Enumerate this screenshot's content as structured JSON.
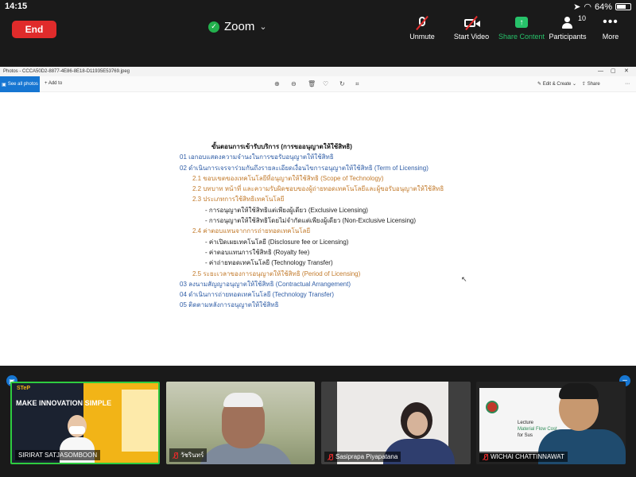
{
  "status": {
    "time": "14:15",
    "battery": "64%"
  },
  "zoom": {
    "end_label": "End",
    "meeting_title": "Zoom",
    "toolbar": {
      "unmute": "Unmute",
      "start_video": "Start Video",
      "share_content": "Share Content",
      "participants": "Participants",
      "participants_count": "10",
      "more": "More"
    }
  },
  "photos": {
    "window_title": "Photos - CCCA50D2-8877-4E86-8E18-D11935E53769.jpeg",
    "see_all": "See all photos",
    "add_to": "Add to",
    "edit_create": "Edit & Create",
    "share": "Share"
  },
  "document": {
    "title": "ขั้นตอนการเข้ารับบริการ (การขออนุญาตให้ใช้สิทธิ)",
    "lines": [
      "01 เอกอบแสดงความจำนงในการขอรับอนุญาตให้ใช้สิทธิ",
      "02 ดำเนินการเจรจาร่วมกันถึงรายละเอียดเงื่อนไขการอนุญาตให้ใช้สิทธิ (Term of Licensing)",
      "2.1 ขอบเขตของเทคโนโลยีที่อนุญาตให้ใช้สิทธิ (Scope of Technology)",
      "2.2 บทบาท หน้าที่ และความรับผิดชอบของผู้ถ่ายทอดเทคโนโลยีและผู้ขอรับอนุญาตให้ใช้สิทธิ",
      "2.3 ประเภทการใช้สิทธิเทคโนโลยี",
      "- การอนุญาตให้ใช้สิทธิแต่เพียงผู้เดียว (Exclusive Licensing)",
      "- การอนุญาตให้ใช้สิทธิโดยไม่จำกัดแต่เพียงผู้เดียว (Non-Exclusive Licensing)",
      "2.4 ค่าตอบแทนจากการถ่ายทอดเทคโนโลยี",
      "- ค่าเปิดเผยเทคโนโลยี (Disclosure fee or Licensing)",
      "- ค่าตอบแทนการใช้สิทธิ (Royalty fee)",
      "- ค่าถ่ายทอดเทคโนโลยี (Technology Transfer)",
      "2.5 ระยะเวลาของการอนุญาตให้ใช้สิทธิ (Period of Licensing)",
      "03 ลงนามสัญญาอนุญาตให้ใช้สิทธิ (Contractual Arrangement)",
      "04 ดำเนินการถ่ายทอดเทคโนโลยี (Technology Transfer)",
      "05 ติดตามหลังการอนุญาตให้ใช้สิทธิ"
    ]
  },
  "participants": [
    {
      "name": "SIRIRAT SATJASOMBOON",
      "muted": false,
      "slogan": "MAKE INNOVATION SIMPLE",
      "logo": "STeP"
    },
    {
      "name": "วัชรินทร์",
      "muted": true
    },
    {
      "name": "Sasiprapa Piyapatana",
      "muted": true
    },
    {
      "name": "WICHAI CHATTINNAWAT",
      "muted": true,
      "slide_line1": "Lecture",
      "slide_line2": "Material Flow Cost",
      "slide_line3": "for Sus"
    }
  ]
}
